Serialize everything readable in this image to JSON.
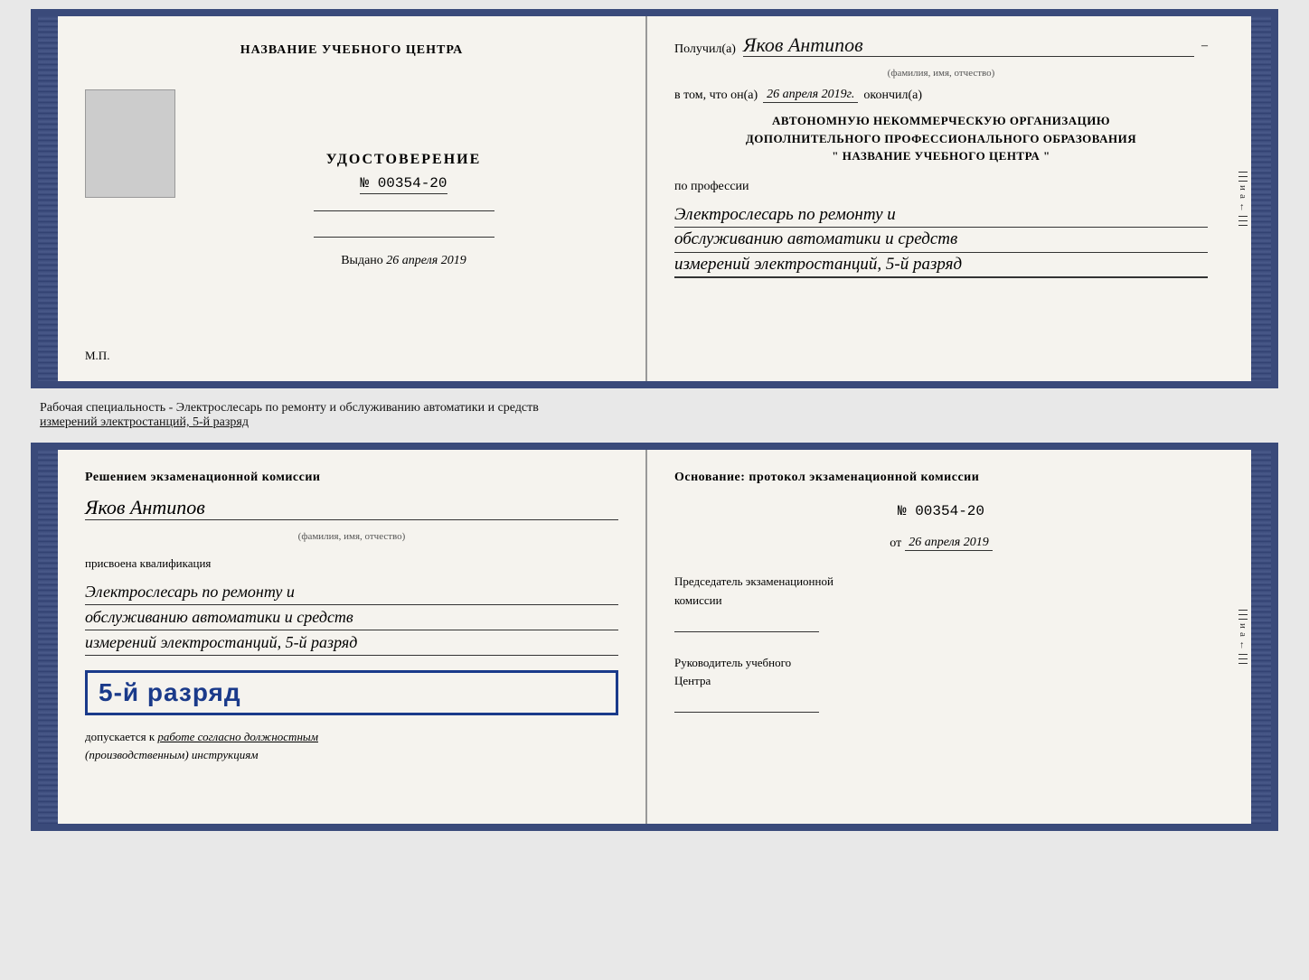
{
  "top_doc": {
    "left": {
      "center_title": "НАЗВАНИЕ УЧЕБНОГО ЦЕНТРА",
      "cert_title": "УДОСТОВЕРЕНИЕ",
      "cert_number": "№ 00354-20",
      "issued_label": "Выдано",
      "issued_date": "26 апреля 2019",
      "mp_label": "М.П."
    },
    "right": {
      "recipient_label": "Получил(а)",
      "recipient_name": "Яков Антипов",
      "fio_label": "(фамилия, имя, отчество)",
      "date_prefix": "в том, что он(а)",
      "date_value": "26 апреля 2019г.",
      "date_suffix": "окончил(а)",
      "org_line1": "АВТОНОМНУЮ НЕКОММЕРЧЕСКУЮ ОРГАНИЗАЦИЮ",
      "org_line2": "ДОПОЛНИТЕЛЬНОГО ПРОФЕССИОНАЛЬНОГО ОБРАЗОВАНИЯ",
      "org_line3": "\"    НАЗВАНИЕ УЧЕБНОГО ЦЕНТРА    \"",
      "profession_label": "по профессии",
      "profession_line1": "Электрослесарь по ремонту и",
      "profession_line2": "обслуживанию автоматики и средств",
      "profession_line3": "измерений электростанций, 5-й разряд"
    }
  },
  "middle_text": {
    "line1": "Рабочая специальность - Электрослесарь по ремонту и обслуживанию автоматики и средств",
    "line2": "измерений электростанций, 5-й разряд"
  },
  "bottom_doc": {
    "left": {
      "decision_title": "Решением экзаменационной комиссии",
      "person_name": "Яков Антипов",
      "fio_label": "(фамилия, имя, отчество)",
      "qualified_label": "присвоена квалификация",
      "qualified_line1": "Электрослесарь по ремонту и",
      "qualified_line2": "обслуживанию автоматики и средств",
      "qualified_line3": "измерений электростанций, 5-й разряд",
      "grade_stamp": "5-й разряд",
      "admitted_text": "допускается к",
      "admitted_handwritten": "работе согласно должностным",
      "admitted_italic": "(производственным) инструкциям"
    },
    "right": {
      "basis_title": "Основание: протокол экзаменационной комиссии",
      "protocol_number": "№  00354-20",
      "date_prefix": "от",
      "date_value": "26 апреля 2019",
      "chairman_label1": "Председатель экзаменационной",
      "chairman_label2": "комиссии",
      "director_label1": "Руководитель учебного",
      "director_label2": "Центра"
    }
  },
  "side_chars": {
    "и": "и",
    "а": "а",
    "left_arrow": "←"
  }
}
